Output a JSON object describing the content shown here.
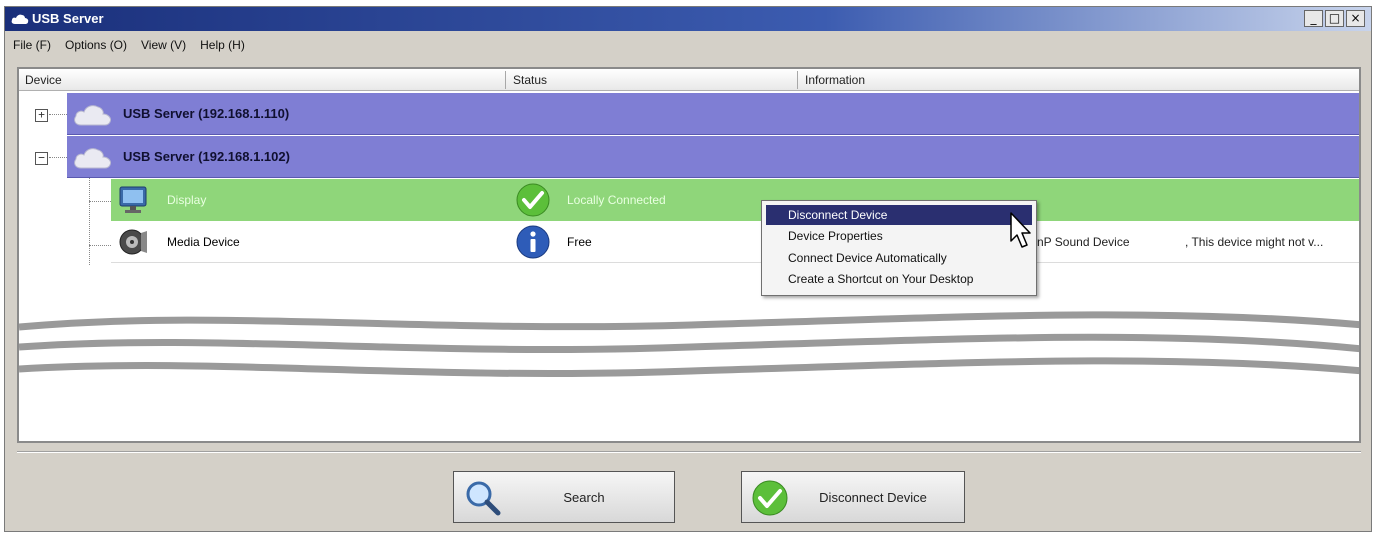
{
  "window": {
    "title": "USB Server",
    "controls": {
      "minimize": "_",
      "maximize": "□",
      "close": "×"
    }
  },
  "menubar": {
    "items": [
      {
        "label": "File (F)"
      },
      {
        "label": "Options (O)"
      },
      {
        "label": "View (V)"
      },
      {
        "label": "Help (H)"
      }
    ]
  },
  "columns": [
    {
      "label": "Device"
    },
    {
      "label": "Status"
    },
    {
      "label": "Information"
    }
  ],
  "servers": [
    {
      "label": "USB Server  (192.168.1.110)",
      "expander": "+",
      "icon": "cloud-icon"
    },
    {
      "label": "USB Server  (192.168.1.102)",
      "expander": "−",
      "icon": "cloud-icon"
    }
  ],
  "devices": [
    {
      "name": "Display",
      "status": "Locally Connected",
      "status_icon": "check-icon",
      "info": "",
      "selected": true
    },
    {
      "name": "Media Device",
      "status": "Free",
      "status_icon": "info-icon",
      "info": "nP Sound Device",
      "info2": ", This device might not v...",
      "selected": false
    }
  ],
  "context_menu": {
    "items": [
      {
        "label": "Disconnect Device",
        "active": true
      },
      {
        "label": "Device Properties",
        "active": false
      },
      {
        "label": "Connect Device Automatically",
        "active": false
      },
      {
        "label": "Create a Shortcut on Your Desktop",
        "active": false
      }
    ]
  },
  "buttons": {
    "search_label": "Search",
    "disconnect_label": "Disconnect Device"
  },
  "colors": {
    "server_row": "#7f7ed4",
    "selected_row": "#8fd67a",
    "menu_active": "#2a2f70",
    "titlebar": "#1a2f7a"
  }
}
